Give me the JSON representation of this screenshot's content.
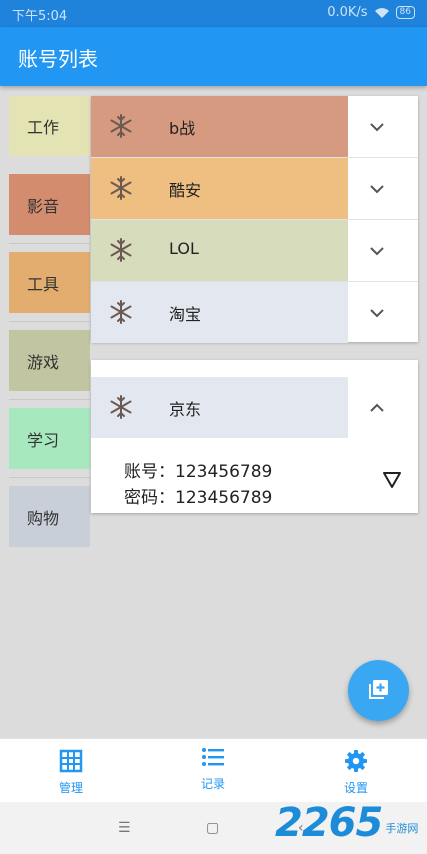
{
  "status_bar": {
    "time": "下午5:04",
    "net_speed": "0.0K/s",
    "battery": "86"
  },
  "app_bar": {
    "title": "账号列表"
  },
  "categories": [
    {
      "label": "工作",
      "color": "#e3e3b4"
    },
    {
      "label": "影音",
      "color": "#d48c6f"
    },
    {
      "label": "工具",
      "color": "#e3ad70"
    },
    {
      "label": "游戏",
      "color": "#c2c5a1"
    },
    {
      "label": "学习",
      "color": "#a8e8bf"
    },
    {
      "label": "购物",
      "color": "#c9cfd8"
    }
  ],
  "accounts": [
    {
      "name": "b战",
      "color": "#d69a80"
    },
    {
      "name": "酷安",
      "color": "#eebf80"
    },
    {
      "name": "LOL",
      "color": "#d7dcbc"
    },
    {
      "name": "淘宝",
      "color": "#e3e8f0"
    }
  ],
  "expanded_account": {
    "name": "京东",
    "color": "#e3e8f0",
    "account_line": "账号：123456789",
    "password_line": "密码：123456789"
  },
  "bottom_nav": [
    {
      "label": "管理",
      "icon": "grid-icon"
    },
    {
      "label": "记录",
      "icon": "list-icon"
    },
    {
      "label": "设置",
      "icon": "gear-icon"
    }
  ],
  "watermark": {
    "number": "2265",
    "text": "手游网"
  },
  "accent_color": "#2196f3"
}
